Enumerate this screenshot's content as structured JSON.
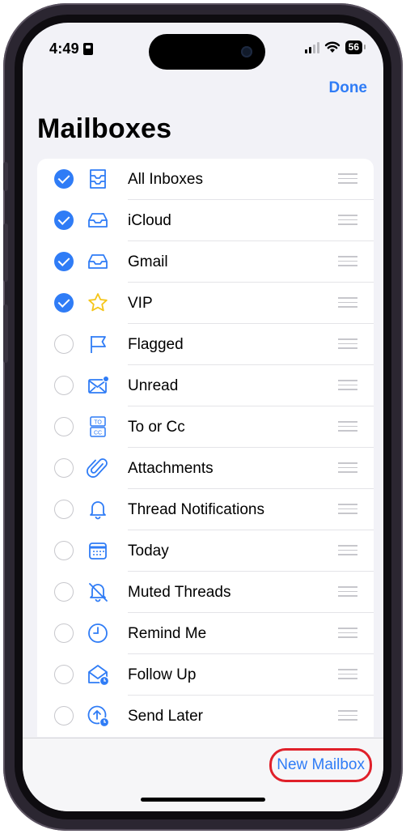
{
  "status_bar": {
    "time": "4:49",
    "battery": "56"
  },
  "nav": {
    "done_label": "Done"
  },
  "page": {
    "title": "Mailboxes"
  },
  "mailboxes": [
    {
      "label": "All Inboxes",
      "checked": true,
      "icon": "all-inboxes-icon"
    },
    {
      "label": "iCloud",
      "checked": true,
      "icon": "inbox-icon"
    },
    {
      "label": "Gmail",
      "checked": true,
      "icon": "inbox-icon"
    },
    {
      "label": "VIP",
      "checked": true,
      "icon": "star-icon"
    },
    {
      "label": "Flagged",
      "checked": false,
      "icon": "flag-icon"
    },
    {
      "label": "Unread",
      "checked": false,
      "icon": "envelope-badge-icon"
    },
    {
      "label": "To or Cc",
      "checked": false,
      "icon": "to-cc-icon"
    },
    {
      "label": "Attachments",
      "checked": false,
      "icon": "paperclip-icon"
    },
    {
      "label": "Thread Notifications",
      "checked": false,
      "icon": "bell-icon"
    },
    {
      "label": "Today",
      "checked": false,
      "icon": "calendar-icon"
    },
    {
      "label": "Muted Threads",
      "checked": false,
      "icon": "bell-slash-icon"
    },
    {
      "label": "Remind Me",
      "checked": false,
      "icon": "clock-icon"
    },
    {
      "label": "Follow Up",
      "checked": false,
      "icon": "envelope-clock-icon"
    },
    {
      "label": "Send Later",
      "checked": false,
      "icon": "send-later-icon"
    }
  ],
  "toolbar": {
    "new_mailbox_label": "New Mailbox"
  },
  "colors": {
    "accent": "#2f7cf6",
    "highlight_ring": "#e0202a",
    "star": "#f5c518"
  }
}
